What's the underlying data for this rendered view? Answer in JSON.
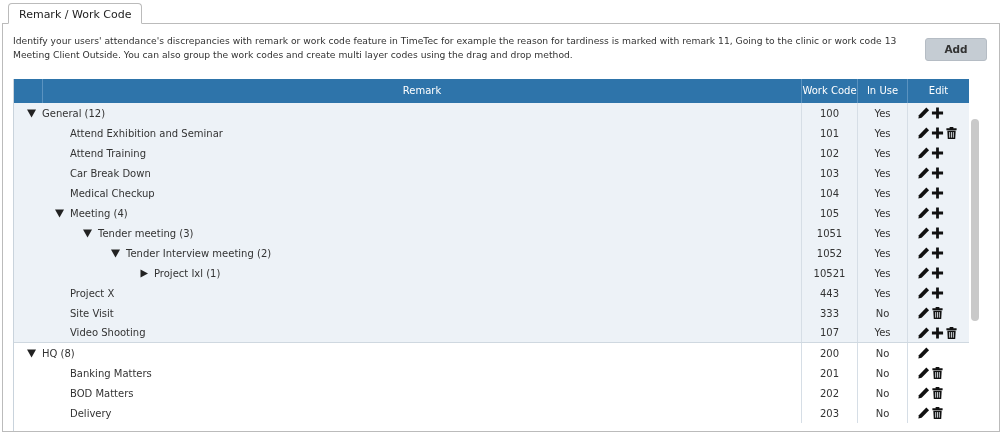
{
  "tabs": [
    {
      "label": "Remark / Work Code",
      "selected": true
    }
  ],
  "description": "Identify your users' attendance's discrepancies with remark or work code feature in TimeTec for example the reason for tardiness is marked with remark 11, Going to the clinic or work code 13 Meeting Client Outside. You can also group the work codes and create multi layer codes using the drag and drop method.",
  "add_button": "Add",
  "table": {
    "columns": [
      "Remark",
      "Work Code",
      "In Use",
      "Edit"
    ],
    "rows": [
      {
        "name": "General (12)",
        "code": "100",
        "in_use": "Yes",
        "edit": true,
        "add": true,
        "delete": false,
        "expanded": true,
        "selected": true,
        "children": [
          {
            "name": "Attend Exhibition and Seminar",
            "code": "101",
            "in_use": "Yes",
            "edit": true,
            "add": true,
            "delete": true
          },
          {
            "name": "Attend Training",
            "code": "102",
            "in_use": "Yes",
            "edit": true,
            "add": true,
            "delete": false
          },
          {
            "name": "Car Break Down",
            "code": "103",
            "in_use": "Yes",
            "edit": true,
            "add": true,
            "delete": false
          },
          {
            "name": "Medical Checkup",
            "code": "104",
            "in_use": "Yes",
            "edit": true,
            "add": true,
            "delete": false
          },
          {
            "name": "Meeting (4)",
            "code": "105",
            "in_use": "Yes",
            "edit": true,
            "add": true,
            "delete": false,
            "expanded": true,
            "children": [
              {
                "name": "Tender meeting (3)",
                "code": "1051",
                "in_use": "Yes",
                "edit": true,
                "add": true,
                "delete": false,
                "expanded": true,
                "children": [
                  {
                    "name": "Tender Interview meeting (2)",
                    "code": "1052",
                    "in_use": "Yes",
                    "edit": true,
                    "add": true,
                    "delete": false,
                    "expanded": true,
                    "children": [
                      {
                        "name": "Project Ixl (1)",
                        "code": "10521",
                        "in_use": "Yes",
                        "edit": true,
                        "add": true,
                        "delete": false,
                        "expanded": false
                      }
                    ]
                  }
                ]
              }
            ]
          },
          {
            "name": "Project X",
            "code": "443",
            "in_use": "Yes",
            "edit": true,
            "add": true,
            "delete": false
          },
          {
            "name": "Site Visit",
            "code": "333",
            "in_use": "No",
            "edit": true,
            "add": false,
            "delete": true
          },
          {
            "name": "Video Shooting",
            "code": "107",
            "in_use": "Yes",
            "edit": true,
            "add": true,
            "delete": true
          }
        ]
      },
      {
        "name": "HQ (8)",
        "code": "200",
        "in_use": "No",
        "edit": true,
        "add": false,
        "delete": false,
        "expanded": true,
        "selected": false,
        "children": [
          {
            "name": "Banking Matters",
            "code": "201",
            "in_use": "No",
            "edit": true,
            "add": false,
            "delete": true
          },
          {
            "name": "BOD Matters",
            "code": "202",
            "in_use": "No",
            "edit": true,
            "add": false,
            "delete": true
          },
          {
            "name": "Delivery",
            "code": "203",
            "in_use": "No",
            "edit": true,
            "add": false,
            "delete": true
          }
        ]
      }
    ]
  }
}
